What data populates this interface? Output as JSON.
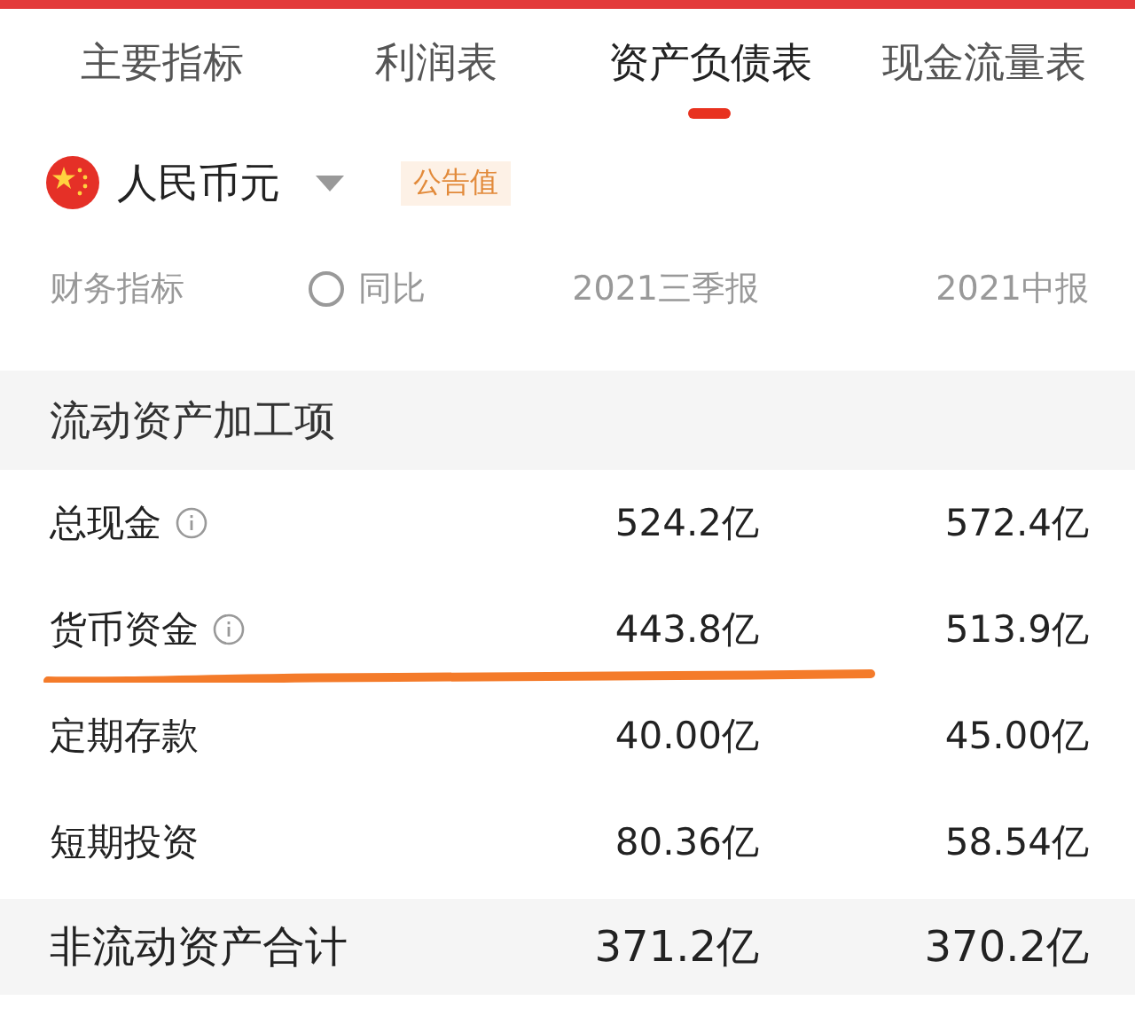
{
  "tabs": [
    {
      "label": "主要指标",
      "selected": false
    },
    {
      "label": "利润表",
      "selected": false
    },
    {
      "label": "资产负债表",
      "selected": true
    },
    {
      "label": "现金流量表",
      "selected": false
    }
  ],
  "currency": {
    "label": "人民币元",
    "badge": "公告值"
  },
  "header": {
    "label": "财务指标",
    "compare": {
      "label": "同比",
      "checked": false
    },
    "columns": [
      "2021三季报",
      "2021中报"
    ]
  },
  "section": {
    "title": "流动资产加工项"
  },
  "rows": [
    {
      "label": "总现金",
      "info": true,
      "underlined": false,
      "values": [
        "524.2亿",
        "572.4亿"
      ]
    },
    {
      "label": "货币资金",
      "info": true,
      "underlined": true,
      "values": [
        "443.8亿",
        "513.9亿"
      ]
    },
    {
      "label": "定期存款",
      "info": false,
      "underlined": false,
      "values": [
        "40.00亿",
        "45.00亿"
      ]
    },
    {
      "label": "短期投资",
      "info": false,
      "underlined": false,
      "values": [
        "80.36亿",
        "58.54亿"
      ]
    }
  ],
  "total": {
    "label": "非流动资产合计",
    "values": [
      "371.2亿",
      "370.2亿"
    ]
  }
}
